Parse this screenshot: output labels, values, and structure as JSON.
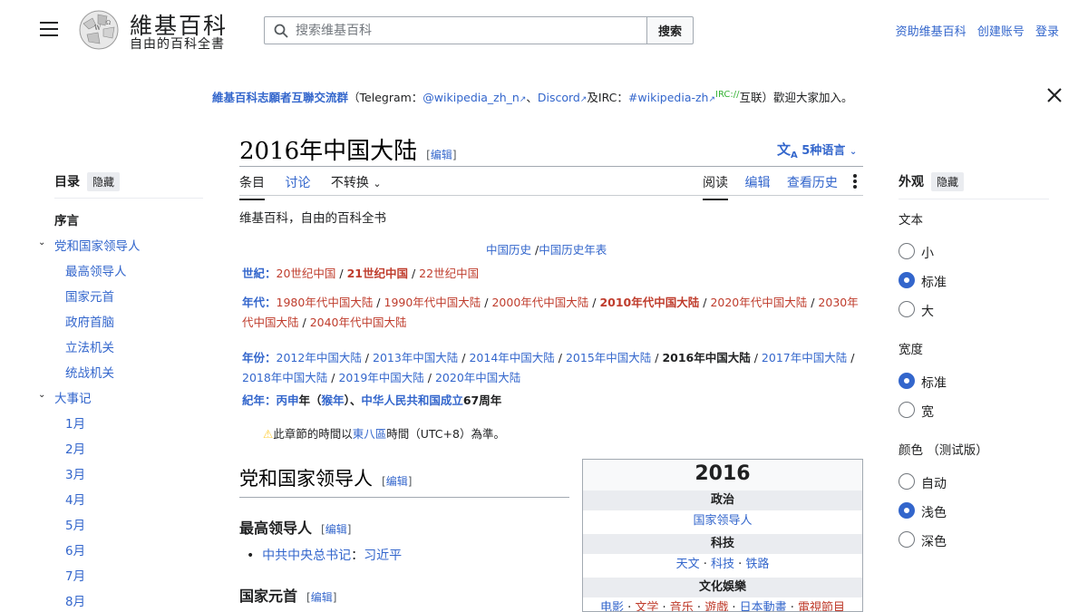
{
  "header": {
    "logo_word": "維基百科",
    "logo_tagline": "自由的百科全書",
    "search_placeholder": "搜索维基百科",
    "search_button": "搜索",
    "user_links": [
      "资助维基百科",
      "创建账号",
      "登录"
    ]
  },
  "banner": {
    "group": "維基百科志願者互聯交流群",
    "open": "（Telegram：",
    "telegram": "@wikipedia_zh_n",
    "sep1": "、",
    "discord": "Discord",
    "and": "及IRC：",
    "irc_channel": "#wikipedia-zh",
    "irc_tag": "IRC://",
    "close": "互联）歡迎大家加入。"
  },
  "title": {
    "text": "2016年中国大陆",
    "edit_open": "[",
    "edit": "编辑",
    "edit_close": "]",
    "languages": "5种语言"
  },
  "tabs": {
    "left": [
      "条目",
      "讨论",
      "不转换"
    ],
    "right": [
      "阅读",
      "编辑",
      "查看历史"
    ]
  },
  "tagline": "维基百科，自由的百科全书",
  "nav": {
    "history": "中国历史",
    "history_sep": " /",
    "history_table": "中国历史年表",
    "century_label": "世紀：",
    "centuries": [
      "20世纪中国",
      "21世纪中国",
      "22世纪中国"
    ],
    "decade_label": "年代：",
    "decades_line1": [
      "1980年代中国大陆",
      "1990年代中国大陆",
      "2000年代中国大陆",
      "2010年代中国大陆",
      "2020年代中国大陆",
      "2030年"
    ],
    "decades_line2": [
      "代中国大陆",
      "2040年代中国大陆"
    ],
    "year_label": "年份：",
    "years_line1": [
      "2012年中国大陆",
      "2013年中国大陆",
      "2014年中国大陆",
      "2015年中国大陆",
      "2016年中国大陆",
      "2017年中国大陆"
    ],
    "years_line2": [
      "2018年中国大陆",
      "2019年中国大陆",
      "2020年中国大陆"
    ],
    "era_label": "紀年：",
    "era_bing": "丙申",
    "era_year": "年（",
    "era_monkey": "猴年",
    "era_close": "）、",
    "era_prc": "中华人民共和国成立",
    "era_67": "67周年",
    "slash": " / "
  },
  "notice": {
    "pre": "此章節的時間以",
    "link": "東八區",
    "post": "時間（UTC+8）為準。"
  },
  "sections": {
    "h2_leaders": "党和国家领导人",
    "h3_supreme": "最高领导人",
    "item_label": "中共中央总书记",
    "item_sep": "：",
    "item_value": "习近平",
    "h3_head_of_state": "国家元首",
    "edit": "编辑"
  },
  "infobox": {
    "year": "2016",
    "politics": "政治",
    "politics_link": "国家领导人",
    "tech": "科技",
    "tech_links": [
      "天文",
      "科技",
      "铁路"
    ],
    "culture": "文化娛樂",
    "culture_links": [
      "电影",
      "文学",
      "音乐",
      "遊戲",
      "日本動畫",
      "電視節目"
    ]
  },
  "toc": {
    "title": "目录",
    "hide": "隐藏",
    "items": [
      {
        "label": "序言",
        "level": 0
      },
      {
        "label": "党和国家领导人",
        "level": 1
      },
      {
        "label": "最高领导人",
        "level": 2
      },
      {
        "label": "国家元首",
        "level": 2
      },
      {
        "label": "政府首脑",
        "level": 2
      },
      {
        "label": "立法机关",
        "level": 2
      },
      {
        "label": "统战机关",
        "level": 2
      },
      {
        "label": "大事记",
        "level": 1
      },
      {
        "label": "1月",
        "level": 2
      },
      {
        "label": "2月",
        "level": 2
      },
      {
        "label": "3月",
        "level": 2
      },
      {
        "label": "4月",
        "level": 2
      },
      {
        "label": "5月",
        "level": 2
      },
      {
        "label": "6月",
        "level": 2
      },
      {
        "label": "7月",
        "level": 2
      },
      {
        "label": "8月",
        "level": 2
      }
    ]
  },
  "appearance": {
    "title": "外观",
    "hide": "隐藏",
    "text_label": "文本",
    "text_options": [
      "小",
      "标准",
      "大"
    ],
    "width_label": "宽度",
    "width_options": [
      "标准",
      "宽"
    ],
    "color_label": "颜色 （测试版）",
    "color_options": [
      "自动",
      "浅色",
      "深色"
    ],
    "text_selected": "标准",
    "width_selected": "标准",
    "color_selected": "浅色"
  },
  "colors": {
    "link": "#3366cc",
    "redlink": "#bf3c2c",
    "accent": "#3366cc"
  }
}
